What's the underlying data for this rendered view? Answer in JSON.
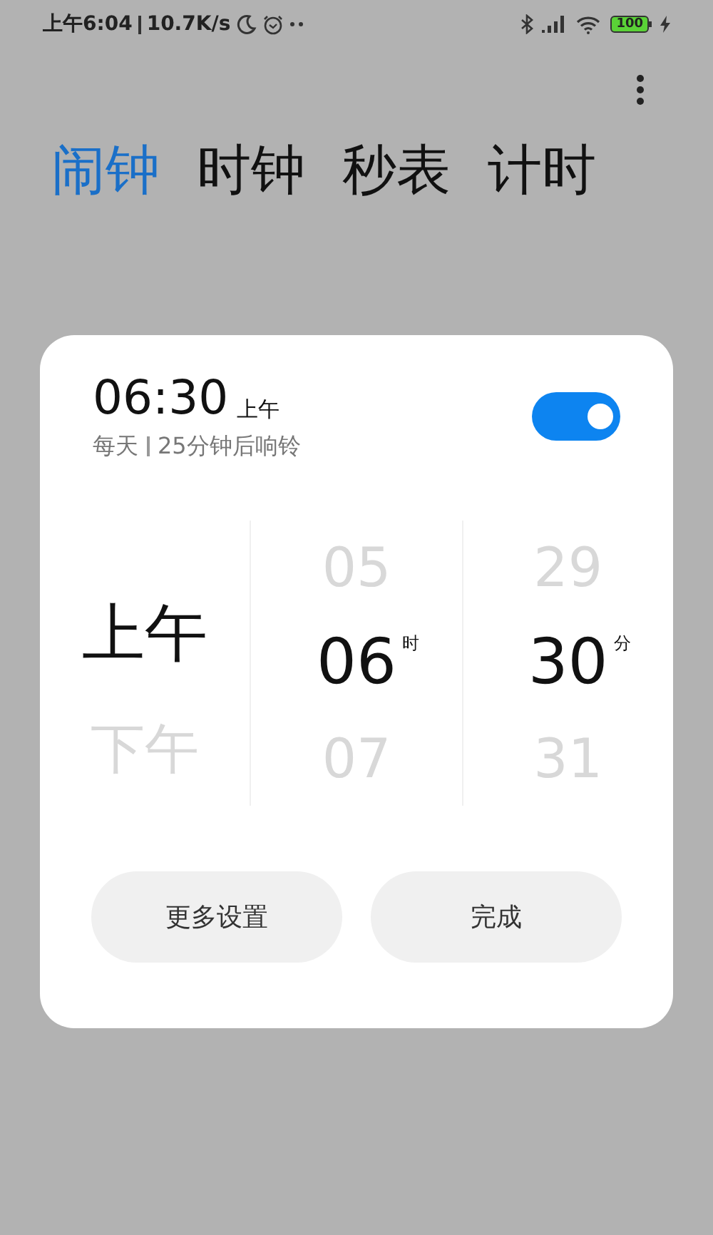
{
  "status_bar": {
    "time": "上午6:04",
    "speed": "10.7K/s",
    "battery": "100"
  },
  "tabs": [
    {
      "label": "闹钟",
      "selected": true
    },
    {
      "label": "时钟",
      "selected": false
    },
    {
      "label": "秒表",
      "selected": false
    },
    {
      "label": "计时",
      "selected": false
    }
  ],
  "dialog": {
    "time": "06:30",
    "period": "上午",
    "repeat": "每天",
    "countdown": "25分钟后响铃",
    "enabled": true,
    "picker": [
      {
        "items": [
          {
            "label": "上午",
            "selected": true
          },
          {
            "label": "下午",
            "selected": false
          }
        ]
      },
      {
        "unit": "时",
        "items": [
          {
            "label": "05",
            "selected": false
          },
          {
            "label": "06",
            "selected": true
          },
          {
            "label": "07",
            "selected": false
          }
        ]
      },
      {
        "unit": "分",
        "items": [
          {
            "label": "29",
            "selected": false
          },
          {
            "label": "30",
            "selected": true
          },
          {
            "label": "31",
            "selected": false
          }
        ]
      }
    ],
    "buttons": [
      "更多设置",
      "完成"
    ]
  }
}
